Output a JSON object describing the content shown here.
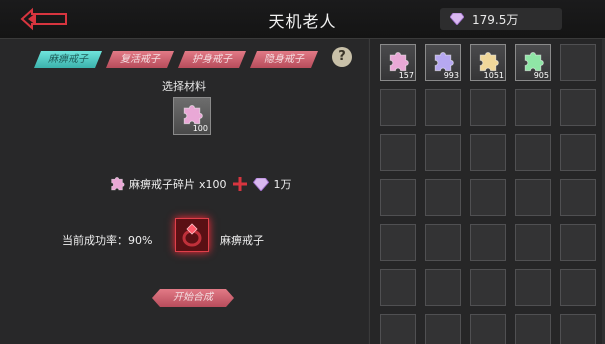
{
  "header": {
    "title": "天机老人",
    "currency_value": "179.5万"
  },
  "tabs": [
    {
      "label": "麻痹戒子",
      "active": true
    },
    {
      "label": "复活戒子",
      "active": false
    },
    {
      "label": "护身戒子",
      "active": false
    },
    {
      "label": "隐身戒子",
      "active": false
    }
  ],
  "help_label": "?",
  "craft": {
    "select_label": "选择材料",
    "material_count": "100",
    "recipe_item": "麻痹戒子碎片",
    "recipe_qty": "x100",
    "recipe_cost": "1万",
    "success_label": "当前成功率：90%",
    "result_name": "麻痹戒子",
    "start_button": "开始合成"
  },
  "inventory": {
    "items": [
      {
        "count": "157",
        "color": "#e9a8d6"
      },
      {
        "count": "993",
        "color": "#b6a8f0"
      },
      {
        "count": "1051",
        "color": "#f0d79a"
      },
      {
        "count": "905",
        "color": "#8fe6a6"
      }
    ],
    "empty_slots": 31
  }
}
